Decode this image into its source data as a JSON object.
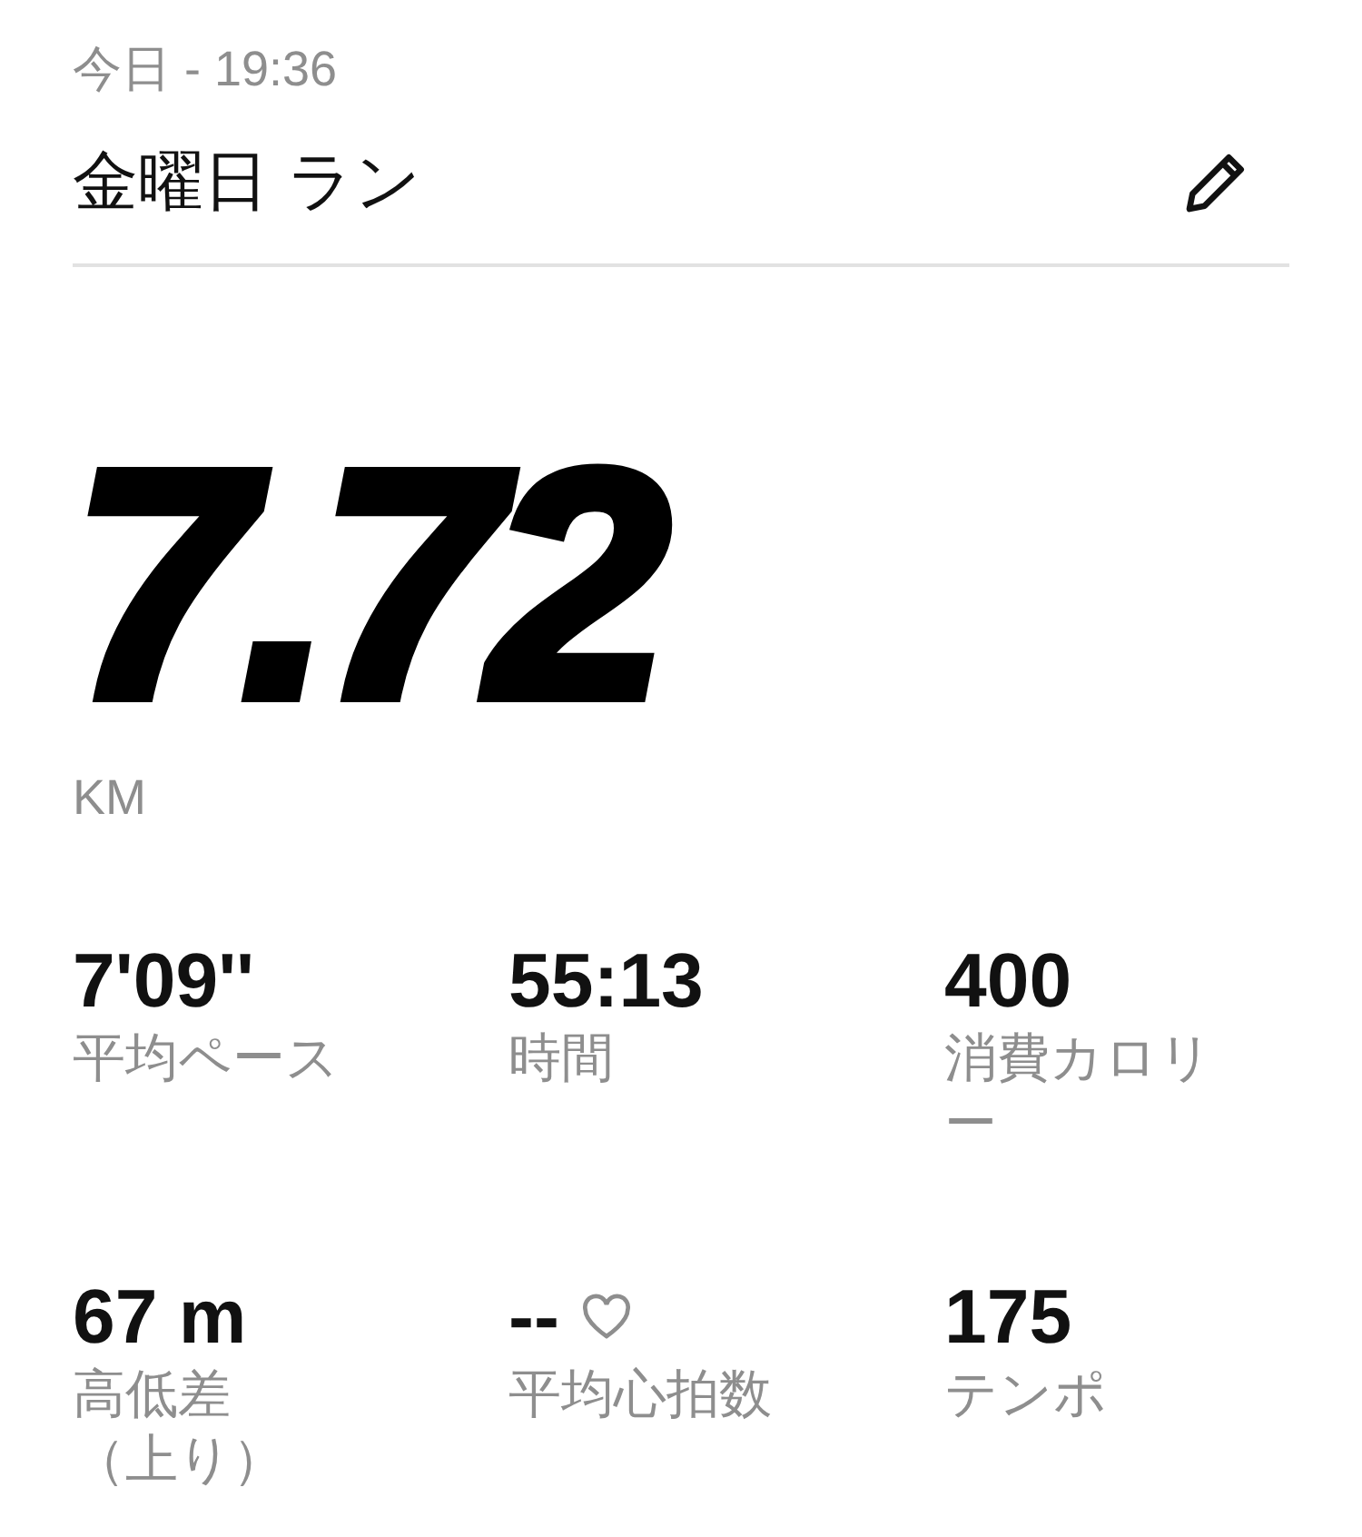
{
  "header": {
    "date": "今日 - 19:36",
    "title": "金曜日 ラン"
  },
  "distance": {
    "value": "7.72",
    "unit": "KM"
  },
  "stats": [
    {
      "value": "7'09''",
      "label_lines": [
        "平均ペース"
      ],
      "heart": false
    },
    {
      "value": "55:13",
      "label_lines": [
        "時間"
      ],
      "heart": false
    },
    {
      "value": "400",
      "label_lines": [
        "消費カロリ",
        "ー"
      ],
      "heart": false
    },
    {
      "value": "67 m",
      "label_lines": [
        "高低差",
        "（上り）"
      ],
      "heart": false
    },
    {
      "value": "--",
      "label_lines": [
        "平均心拍数"
      ],
      "heart": true
    },
    {
      "value": "175",
      "label_lines": [
        "テンポ"
      ],
      "heart": false
    }
  ]
}
